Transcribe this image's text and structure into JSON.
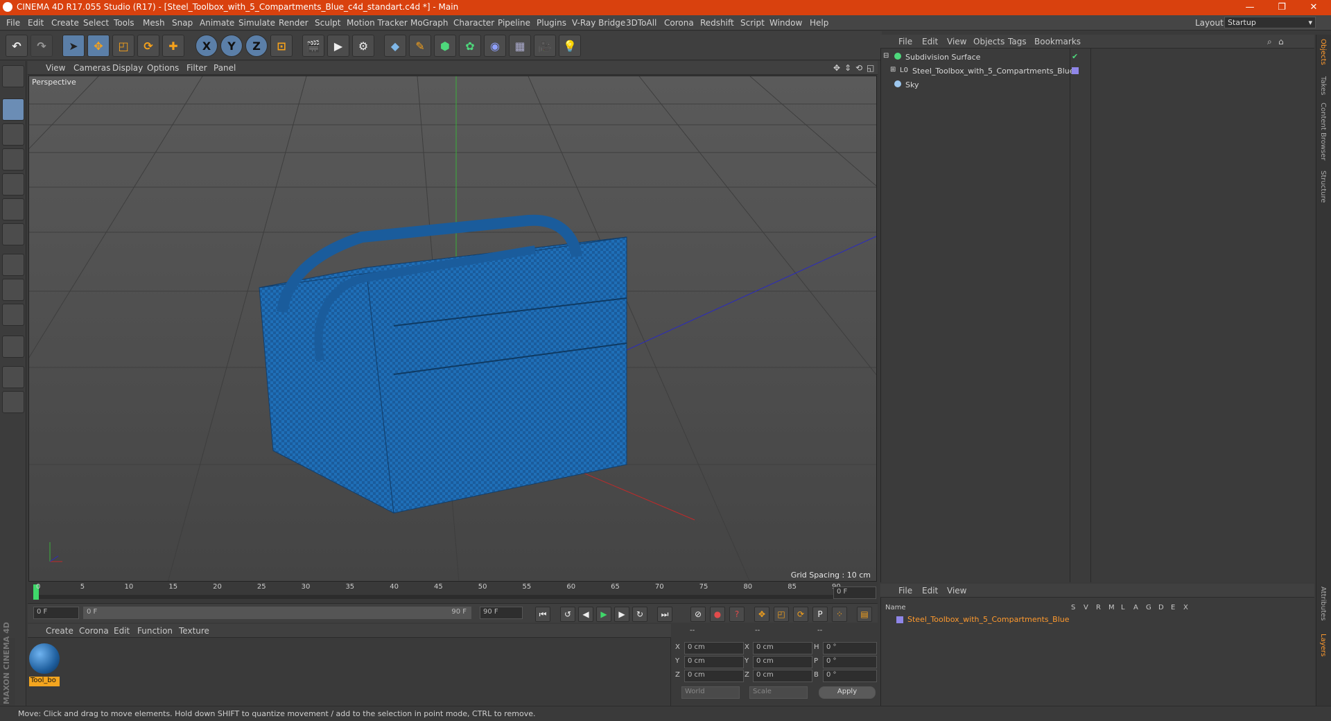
{
  "window": {
    "title": "CINEMA 4D R17.055 Studio (R17) - [Steel_Toolbox_with_5_Compartments_Blue_c4d_standart.c4d *] - Main",
    "minimize": "—",
    "restore": "❐",
    "close": "✕"
  },
  "menubar": {
    "items": [
      "File",
      "Edit",
      "Create",
      "Select",
      "Tools",
      "Mesh",
      "Snap",
      "Animate",
      "Simulate",
      "Render",
      "Sculpt",
      "Motion Tracker",
      "MoGraph",
      "Character",
      "Pipeline",
      "Plugins",
      "V-Ray Bridge",
      "3DToAll",
      "Corona",
      "Redshift",
      "Script",
      "Window",
      "Help"
    ],
    "layout_label": "Layout:",
    "layout_value": "Startup"
  },
  "toolbar": {
    "axis_x": "X",
    "axis_y": "Y",
    "axis_z": "Z"
  },
  "viewport": {
    "menu": [
      "View",
      "Cameras",
      "Display",
      "Options",
      "Filter",
      "Panel"
    ],
    "camera_label": "Perspective",
    "grid_spacing": "Grid Spacing : 10 cm"
  },
  "timeline": {
    "ticks": [
      "0",
      "5",
      "10",
      "15",
      "20",
      "25",
      "30",
      "35",
      "40",
      "45",
      "50",
      "55",
      "60",
      "65",
      "70",
      "75",
      "80",
      "85",
      "90"
    ],
    "current_frame": "0 F",
    "start_field": "0 F",
    "range_start": "0 F",
    "range_end": "90 F",
    "end_field": "90 F"
  },
  "material_manager": {
    "menu": [
      "Create",
      "Corona",
      "Edit",
      "Function",
      "Texture"
    ],
    "material_name": "Tool_bo"
  },
  "coordinates": {
    "headers": [
      "--",
      "--",
      "--"
    ],
    "rows": [
      {
        "a": "X",
        "v1": "0 cm",
        "b": "X",
        "v2": "0 cm",
        "c": "H",
        "v3": "0 °"
      },
      {
        "a": "Y",
        "v1": "0 cm",
        "b": "Y",
        "v2": "0 cm",
        "c": "P",
        "v3": "0 °"
      },
      {
        "a": "Z",
        "v1": "0 cm",
        "b": "Z",
        "v2": "0 cm",
        "c": "B",
        "v3": "0 °"
      }
    ],
    "world": "World",
    "scale": "Scale",
    "apply": "Apply"
  },
  "object_manager": {
    "menu": [
      "File",
      "Edit",
      "View",
      "Objects",
      "Tags",
      "Bookmarks"
    ],
    "objects": [
      "Subdivision Surface",
      "Steel_Toolbox_with_5_Compartments_Blue",
      "Sky"
    ]
  },
  "layer_manager": {
    "menu": [
      "File",
      "Edit",
      "View"
    ],
    "name_header": "Name",
    "flags": [
      "S",
      "V",
      "R",
      "M",
      "L",
      "A",
      "G",
      "D",
      "E",
      "X"
    ],
    "layer_name": "Steel_Toolbox_with_5_Compartments_Blue"
  },
  "side_tabs": [
    "Objects",
    "Takes",
    "Content Browser",
    "Structure",
    "Attributes",
    "Layers"
  ],
  "status": "Move: Click and drag to move elements. Hold down SHIFT to quantize movement / add to the selection in point mode, CTRL to remove.",
  "brand": "MAXON CINEMA 4D",
  "colors": {
    "title_bar": "#d9410e",
    "accent": "#ff9a2e",
    "toolbox_blue": "#1f6fb8"
  }
}
